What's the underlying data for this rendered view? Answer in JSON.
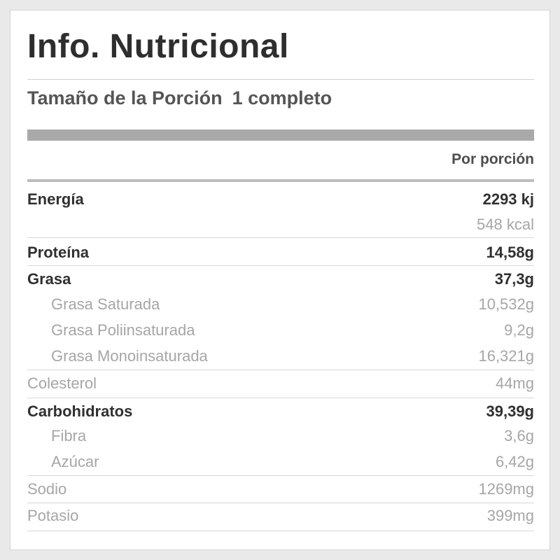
{
  "label": {
    "title": "Info. Nutricional",
    "serving_label": "Tamaño de la Porción",
    "serving_value": "1 completo",
    "column_header": "Por porción",
    "rows": [
      {
        "name": "Energía",
        "amount": "2293 kj"
      },
      {
        "name": "",
        "amount": "548 kcal"
      },
      {
        "name": "Proteína",
        "amount": "14,58g"
      },
      {
        "name": "Grasa",
        "amount": "37,3g"
      },
      {
        "name": "Grasa Saturada",
        "amount": "10,532g"
      },
      {
        "name": "Grasa Poliinsaturada",
        "amount": "9,2g"
      },
      {
        "name": "Grasa Monoinsaturada",
        "amount": "16,321g"
      },
      {
        "name": "Colesterol",
        "amount": "44mg"
      },
      {
        "name": "Carbohidratos",
        "amount": "39,39g"
      },
      {
        "name": "Fibra",
        "amount": "3,6g"
      },
      {
        "name": "Azúcar",
        "amount": "6,42g"
      },
      {
        "name": "Sodio",
        "amount": "1269mg"
      },
      {
        "name": "Potasio",
        "amount": "399mg"
      }
    ]
  }
}
